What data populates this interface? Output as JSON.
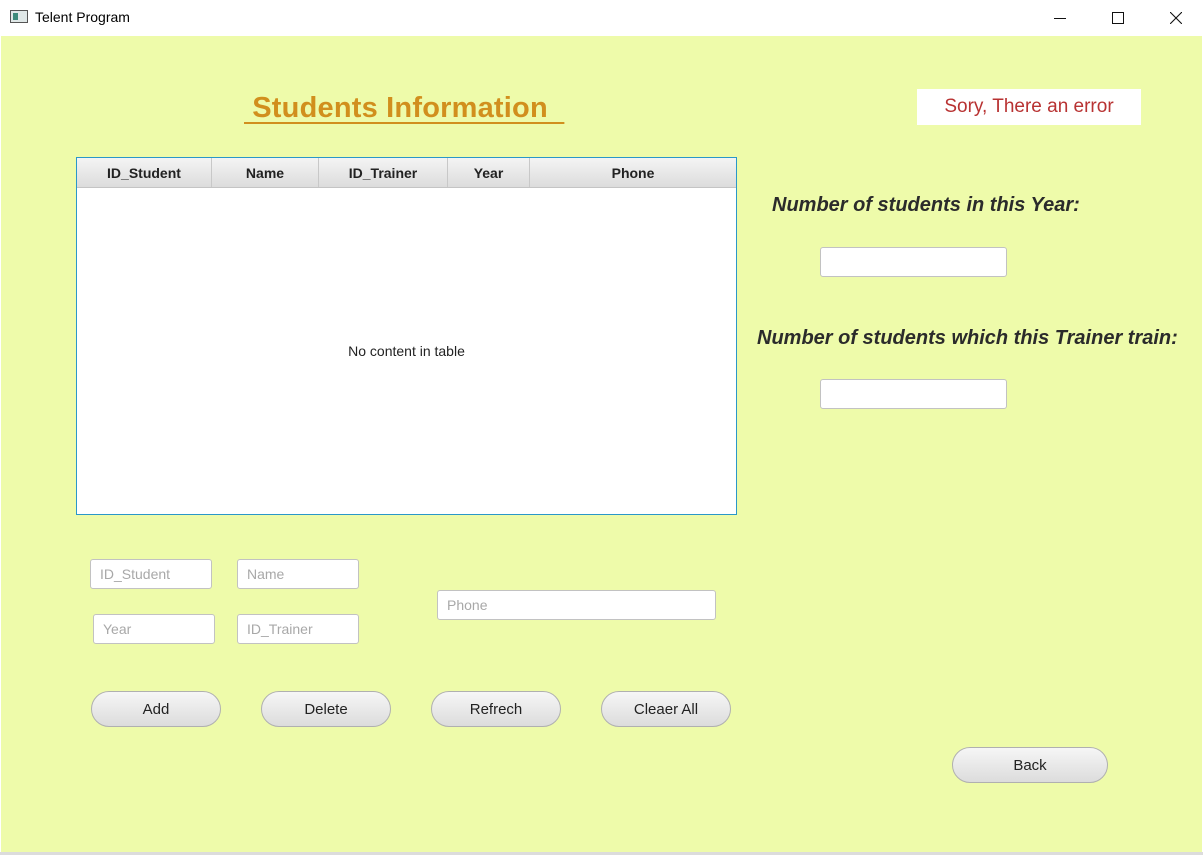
{
  "window": {
    "title": "Telent Program",
    "icon": "app-window-icon",
    "controls": [
      "minimize-icon",
      "maximize-icon",
      "close-icon"
    ]
  },
  "colors": {
    "background": "#eefbaa",
    "heading": "#d18f1d",
    "error_text": "#b83232",
    "table_border": "#2a97c9"
  },
  "header": {
    "title": " Students Information  "
  },
  "error_message": "Sory, There an error",
  "table": {
    "columns": [
      "ID_Student",
      "Name",
      "ID_Trainer",
      "Year",
      "Phone"
    ],
    "rows": [],
    "empty_message": "No content in table"
  },
  "stats": {
    "year_label": "Number of students in this Year:",
    "year_value": "",
    "trainer_label": "Number of students which this Trainer train:",
    "trainer_value": ""
  },
  "form": {
    "id_student": {
      "placeholder": "ID_Student",
      "value": ""
    },
    "name": {
      "placeholder": "Name",
      "value": ""
    },
    "year": {
      "placeholder": "Year",
      "value": ""
    },
    "id_trainer": {
      "placeholder": "ID_Trainer",
      "value": ""
    },
    "phone": {
      "placeholder": "Phone",
      "value": ""
    }
  },
  "buttons": {
    "add": "Add",
    "delete": "Delete",
    "refresh": "Refrech",
    "clear_all": "Cleaer All",
    "back": "Back"
  }
}
